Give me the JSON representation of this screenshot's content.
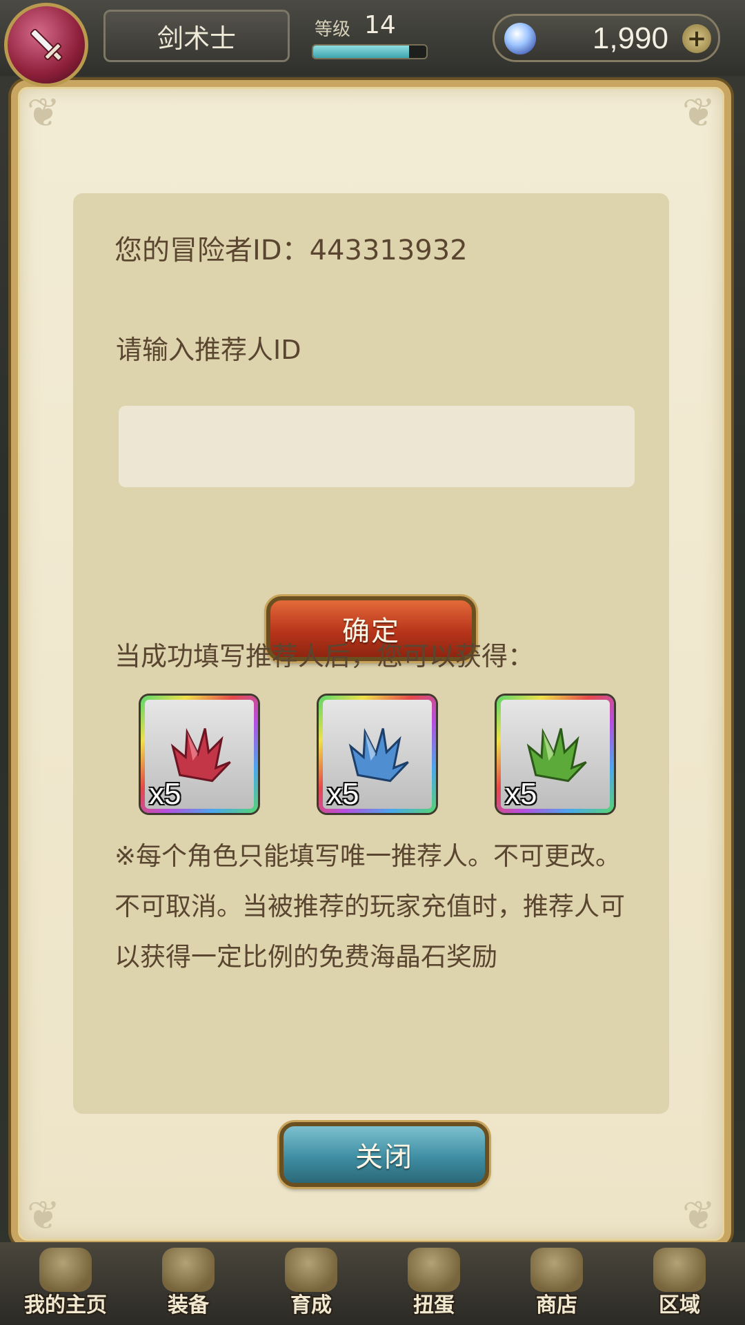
{
  "header": {
    "class_name": "剑术士",
    "level_label": "等级",
    "level_value": "14",
    "level_progress": 0.85,
    "currency_value": "1,990",
    "currency_icon": "sea-crystal-icon",
    "add_icon": "plus-icon",
    "avatar_icon": "sword-icon"
  },
  "dialog": {
    "adventurer_id_label": "您的冒险者ID：443313932",
    "prompt_label": "请输入推荐人ID",
    "referrer_input": {
      "value": "",
      "placeholder": ""
    },
    "confirm_label": "确定",
    "reward_intro": "当成功填写推荐人后，您可以获得：",
    "rewards": [
      {
        "icon": "red-crystal-icon",
        "quantity": "x5",
        "color": "#c23648"
      },
      {
        "icon": "blue-crystal-icon",
        "quantity": "x5",
        "color": "#4f8fd1"
      },
      {
        "icon": "green-crystal-icon",
        "quantity": "x5",
        "color": "#5caa3a"
      }
    ],
    "notice": "※每个角色只能填写唯一推荐人。不可更改。不可取消。当被推荐的玩家充值时，推荐人可以获得一定比例的免费海晶石奖励",
    "close_label": "关闭"
  },
  "bottom_nav": [
    {
      "label": "我的主页",
      "icon": "home-icon"
    },
    {
      "label": "装备",
      "icon": "equipment-icon"
    },
    {
      "label": "育成",
      "icon": "training-icon"
    },
    {
      "label": "扭蛋",
      "icon": "gacha-icon"
    },
    {
      "label": "商店",
      "icon": "shop-icon"
    },
    {
      "label": "区域",
      "icon": "area-icon"
    }
  ],
  "colors": {
    "confirm_button": "#b8351b",
    "close_button": "#3f8ea3",
    "panel": "#ddd3ac",
    "text": "#5a4630"
  }
}
